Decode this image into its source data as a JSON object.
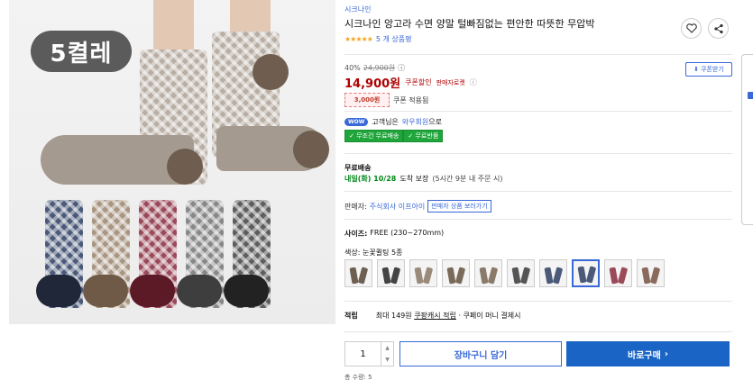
{
  "image": {
    "pack_badge": "5켤레"
  },
  "product": {
    "brand": "시크나인",
    "title": "시크나인 앙고라 수면 양말 털빠짐없는 편안한 따뜻한 무압박",
    "stars": "★★★★★",
    "review_count": "5 개 상품평"
  },
  "actions": {
    "wishlist_icon": "heart-icon",
    "share_icon": "share-icon"
  },
  "pricing": {
    "discount_rate": "40%",
    "original_price": "24,900원",
    "info_icon": "ⓘ",
    "coupon_download": "쿠폰받기",
    "sale_price": "14,900원",
    "price_label": "쿠폰할인",
    "seller_tag": "판매자로켓",
    "coupon_amount": "3,000원",
    "coupon_applied": "쿠폰 적용됨"
  },
  "membership": {
    "wow_badge": "WOW",
    "wow_prefix": "고객님은",
    "wow_link": "와우회원",
    "wow_suffix": "으로",
    "tags": [
      "✓ 무조건 무료배송",
      "✓ 무료반품"
    ]
  },
  "shipping": {
    "label": "무료배송",
    "date": "내일(화) 10/28",
    "arrival": "도착 보장",
    "note": "(5시간 9분 내 주문 시)"
  },
  "seller": {
    "label": "판매자:",
    "name": "주식회사 이프아이",
    "more_button": "판매자 상품 보러가기"
  },
  "options": {
    "size_label": "사이즈:",
    "size_value": "FREE (230~270mm)",
    "color_label": "색상: 눈꽃퀼팅 5종",
    "swatch_count": 10,
    "active_swatch": 7
  },
  "points": {
    "label": "적립",
    "max_text": "최대 149원",
    "link": "쿠팡캐시 적립",
    "suffix": "· 쿠페이 머니 결제시"
  },
  "purchase": {
    "quantity": "1",
    "cart_button": "장바구니 담기",
    "buy_button": "바로구매",
    "buy_arrow": "›",
    "cut_text": "총 수량: 5"
  },
  "colors": {
    "accent": "#3968d8",
    "price": "#ae0000",
    "green": "#1fa63b",
    "buy": "#1964c4"
  }
}
